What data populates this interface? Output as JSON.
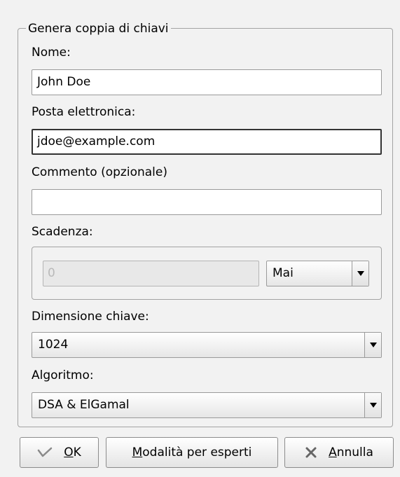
{
  "group_title": "Genera coppia di chiavi",
  "name": {
    "label": "Nome:",
    "value": "John Doe"
  },
  "email": {
    "label": "Posta elettronica:",
    "value": "jdoe@example.com"
  },
  "comment": {
    "label": "Commento (opzionale)",
    "value": ""
  },
  "expiry": {
    "label": "Scadenza:",
    "spin_value": "0",
    "unit_selected": "Mai"
  },
  "key_size": {
    "label": "Dimensione chiave:",
    "selected": "1024"
  },
  "algorithm": {
    "label": "Algoritmo:",
    "selected": "DSA & ElGamal"
  },
  "buttons": {
    "ok": {
      "mnemonic": "O",
      "rest": "K",
      "icon": "checkmark-icon"
    },
    "expert": {
      "mnemonic": "M",
      "rest": "odalità per esperti"
    },
    "cancel": {
      "mnemonic": "A",
      "rest": "nnulla",
      "icon": "cancel-x-icon"
    }
  }
}
